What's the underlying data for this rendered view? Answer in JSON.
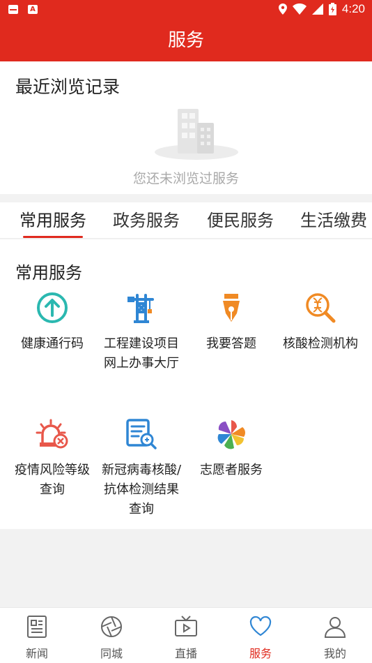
{
  "status_bar": {
    "time": "4:20"
  },
  "header": {
    "title": "服务"
  },
  "recent": {
    "heading": "最近浏览记录",
    "empty_text": "您还未浏览过服务"
  },
  "tabs": [
    {
      "label": "常用服务",
      "active": true
    },
    {
      "label": "政务服务",
      "active": false
    },
    {
      "label": "便民服务",
      "active": false
    },
    {
      "label": "生活缴费",
      "active": false
    }
  ],
  "services": {
    "heading": "常用服务",
    "items": [
      {
        "label": "健康通行码",
        "icon": "arrow-up-circle-icon"
      },
      {
        "label": "工程建设项目网上办事大厅",
        "icon": "crane-icon"
      },
      {
        "label": "我要答题",
        "icon": "pen-nib-icon"
      },
      {
        "label": "核酸检测机构",
        "icon": "dna-magnifier-icon"
      },
      {
        "label": "疫情风险等级查询",
        "icon": "alarm-light-icon"
      },
      {
        "label": "新冠病毒核酸/抗体检测结果查询",
        "icon": "document-search-icon"
      },
      {
        "label": "志愿者服务",
        "icon": "pinwheel-logo-icon"
      }
    ]
  },
  "bottom_nav": [
    {
      "label": "新闻",
      "icon": "newspaper-icon",
      "active": false
    },
    {
      "label": "同城",
      "icon": "aperture-icon",
      "active": false
    },
    {
      "label": "直播",
      "icon": "tv-play-icon",
      "active": false
    },
    {
      "label": "服务",
      "icon": "heart-icon",
      "active": true
    },
    {
      "label": "我的",
      "icon": "user-icon",
      "active": false
    }
  ],
  "colors": {
    "brand_red": "#e02a1e",
    "teal": "#2bb8b0",
    "blue": "#2f86d4",
    "orange": "#f08a24",
    "nav_active": "#e02a1e"
  }
}
